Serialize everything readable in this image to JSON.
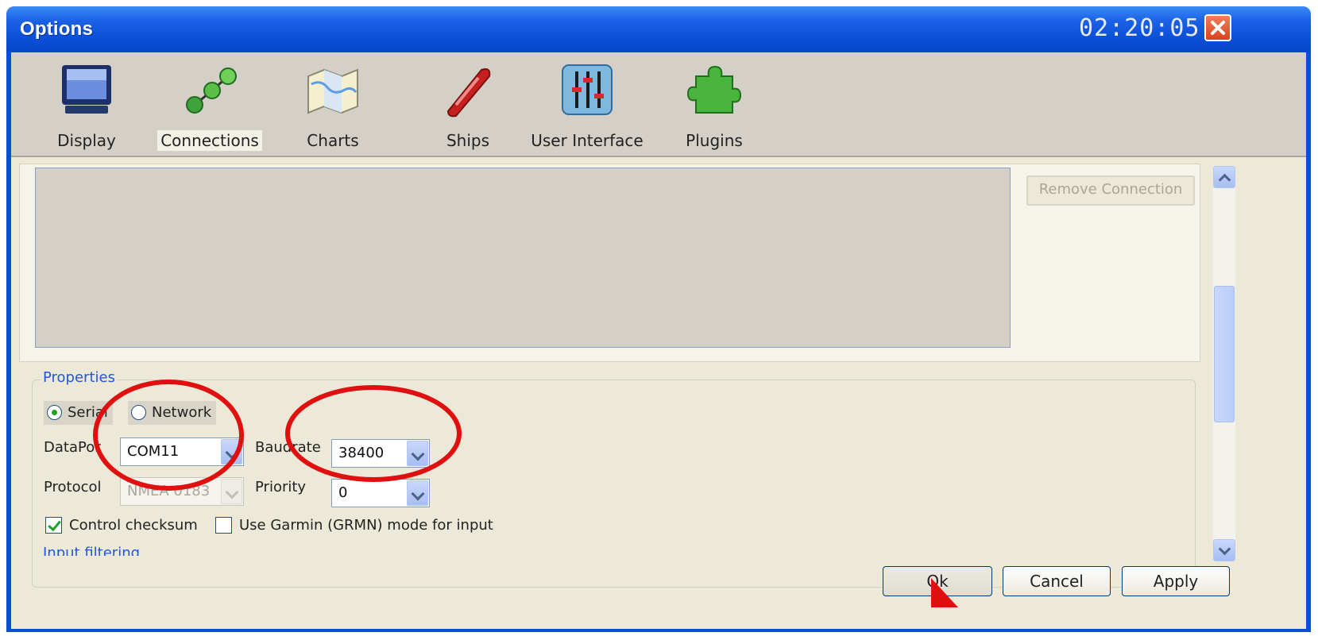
{
  "window": {
    "title": "Options",
    "clock": "02:20:05"
  },
  "toolbar": {
    "items": [
      {
        "label": "Display",
        "icon": "monitor-icon"
      },
      {
        "label": "Connections",
        "icon": "connections-icon",
        "selected": true
      },
      {
        "label": "Charts",
        "icon": "chart-map-icon"
      },
      {
        "label": "Ships",
        "icon": "ship-icon"
      },
      {
        "label": "User Interface",
        "icon": "sliders-icon"
      },
      {
        "label": "Plugins",
        "icon": "puzzle-icon"
      }
    ]
  },
  "connections": {
    "remove_label": "Remove Connection"
  },
  "properties": {
    "legend": "Properties",
    "radio_serial": "Serial",
    "radio_network": "Network",
    "dataport_label": "DataPor",
    "dataport_value": "COM11",
    "baudrate_label": "Baudrate",
    "baudrate_value": "38400",
    "protocol_label": "Protocol",
    "protocol_value": "NMEA 0183",
    "priority_label": "Priority",
    "priority_value": "0",
    "checksum_label": "Control checksum",
    "garmin_label": "Use Garmin (GRMN) mode for input",
    "input_filtering": "Input filtering"
  },
  "buttons": {
    "ok": "Ok",
    "cancel": "Cancel",
    "apply": "Apply"
  },
  "colors": {
    "title_blue": "#0a4fd6",
    "annotation_red": "#e01010",
    "accent_green": "#21a121"
  }
}
